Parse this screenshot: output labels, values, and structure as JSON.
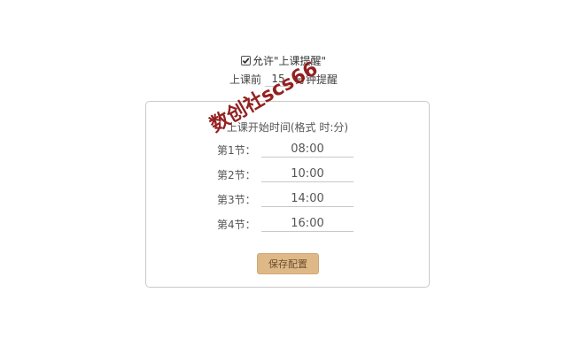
{
  "allow": {
    "checked": true,
    "label": "允许\"上课提醒\""
  },
  "remind": {
    "prefix": "上课前",
    "minutes": "15",
    "suffix": "分钟提醒"
  },
  "panel": {
    "title": "上课开始时间(格式 时:分)",
    "rows": [
      {
        "label": "第1节：",
        "value": "08:00"
      },
      {
        "label": "第2节：",
        "value": "10:00"
      },
      {
        "label": "第3节：",
        "value": "14:00"
      },
      {
        "label": "第4节：",
        "value": "16:00"
      }
    ],
    "save_label": "保存配置"
  },
  "watermark": {
    "text": "数创社scs66"
  },
  "colors": {
    "button_bg": "#dfb887",
    "watermark": "#8b0f0f"
  }
}
